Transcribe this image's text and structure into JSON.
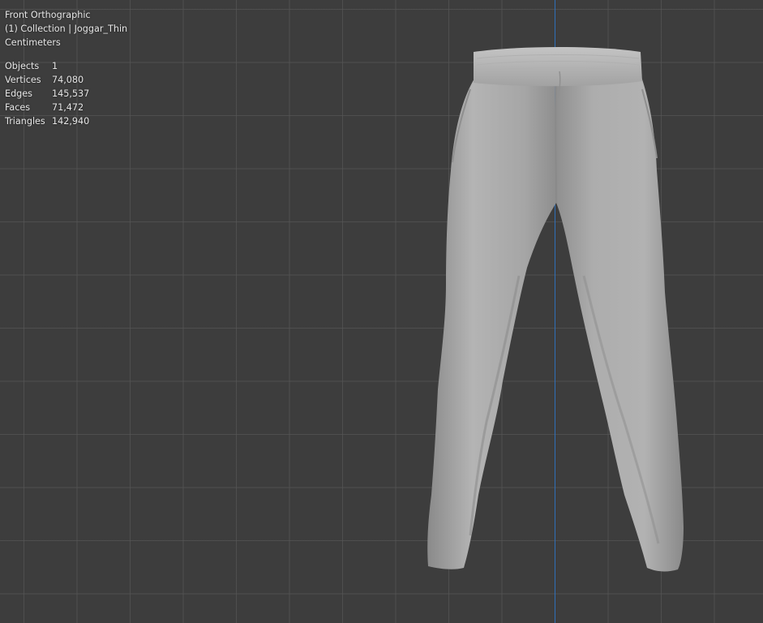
{
  "viewport": {
    "view_name": "Front Orthographic",
    "collection_line": "(1) Collection | Joggar_Thin",
    "units": "Centimeters",
    "stats": [
      {
        "label": "Objects",
        "value": "1"
      },
      {
        "label": "Vertices",
        "value": "74,080"
      },
      {
        "label": "Edges",
        "value": "145,537"
      },
      {
        "label": "Faces",
        "value": "71,472"
      },
      {
        "label": "Triangles",
        "value": "142,940"
      }
    ]
  },
  "colors": {
    "background": "#3d3d3d",
    "grid_line": "#555555",
    "z_axis": "#2f6fb8",
    "text": "#e6e6e6",
    "mesh": "#a9a9a9"
  },
  "mesh": {
    "object": "jogger-pants",
    "shading": "solid"
  }
}
